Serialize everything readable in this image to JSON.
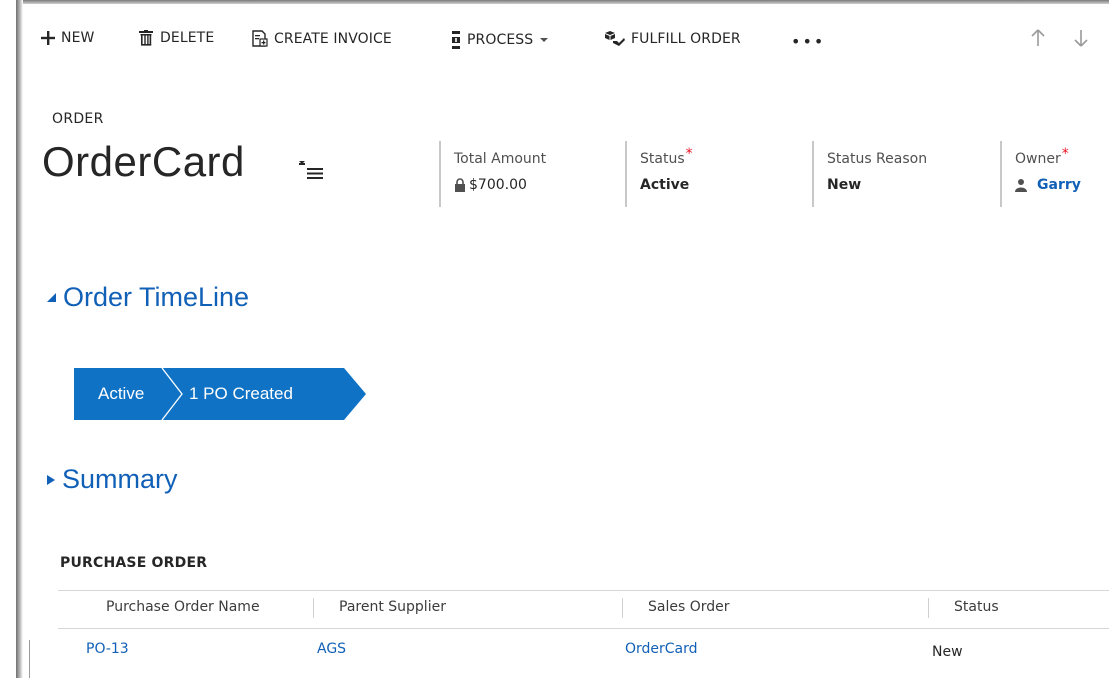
{
  "command_bar": {
    "new_label": "NEW",
    "delete_label": "DELETE",
    "create_invoice_label": "CREATE INVOICE",
    "process_label": "PROCESS",
    "fulfill_order_label": "FULFILL ORDER",
    "more_label": "•••",
    "icons": [
      "plus-icon",
      "trash-icon",
      "invoice-icon",
      "process-icon",
      "chevron-down-icon",
      "fulfill-icon",
      "more-icon",
      "arrow-up-icon",
      "arrow-down-icon"
    ]
  },
  "header": {
    "entity_label": "ORDER",
    "record_title": "OrderCard",
    "fields": {
      "total_amount": {
        "label": "Total Amount",
        "value": "$700.00",
        "locked": true
      },
      "status": {
        "label": "Status",
        "required_mark": "*",
        "value": "Active"
      },
      "status_reason": {
        "label": "Status Reason",
        "value": "New"
      },
      "owner": {
        "label": "Owner",
        "required_mark": "*",
        "value": "Garry"
      }
    }
  },
  "sections": {
    "timeline": {
      "title": "Order TimeLine",
      "expanded": true
    },
    "summary": {
      "title": "Summary",
      "expanded": false
    }
  },
  "stage_bar": {
    "stages": [
      "Active",
      "1 PO Created"
    ],
    "color": "#0f72c5"
  },
  "subgrid": {
    "title": "PURCHASE ORDER",
    "columns": [
      "Purchase Order Name",
      "Parent Supplier",
      "Sales Order",
      "Status"
    ],
    "rows": [
      {
        "name": "PO-13",
        "supplier": "AGS",
        "sales_order": "OrderCard",
        "status": "New"
      }
    ]
  },
  "colors": {
    "link": "#1160b7",
    "required": "#e81123",
    "stage": "#0f72c5"
  }
}
